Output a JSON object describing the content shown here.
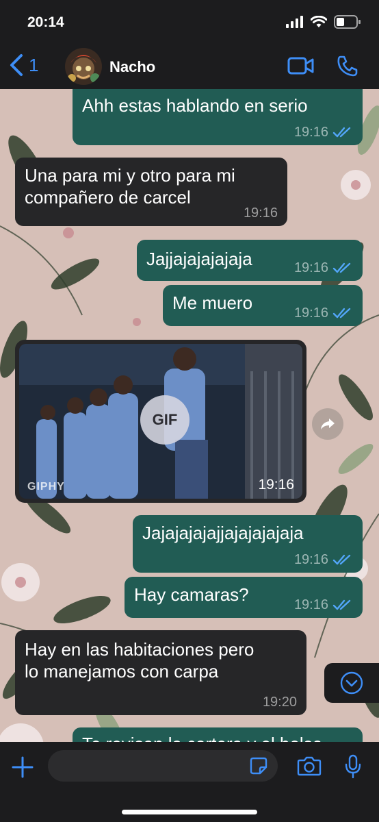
{
  "status_bar": {
    "time": "20:14",
    "icons": [
      "signal-icon",
      "wifi-icon",
      "battery-icon"
    ]
  },
  "header": {
    "back_count": "1",
    "contact_name": "Nacho",
    "icons": [
      "back-chevron-icon",
      "avatar",
      "video-call-icon",
      "voice-call-icon"
    ]
  },
  "messages": [
    {
      "dir": "out",
      "text": "Ahh estas hablando en serio",
      "time": "19:16",
      "status": "read"
    },
    {
      "dir": "in",
      "text": "Una para mi y otro para mi\ncompañero de carcel",
      "time": "19:16"
    },
    {
      "dir": "out",
      "text": "Jajjajajajajaja",
      "time": "19:16",
      "status": "read"
    },
    {
      "dir": "out",
      "text": "Me muero",
      "time": "19:16",
      "status": "read"
    },
    {
      "dir": "in",
      "type": "gif",
      "badge": "GIF",
      "source": "GIPHY",
      "time": "19:16"
    },
    {
      "dir": "out",
      "text": "Jajajajajajjajajajajaja",
      "time": "19:16",
      "status": "read"
    },
    {
      "dir": "out",
      "text": "Hay camaras?",
      "time": "19:16",
      "status": "read"
    },
    {
      "dir": "in",
      "text": "Hay en las habitaciones pero\nlo manejamos con carpa",
      "time": "19:20"
    },
    {
      "dir": "out",
      "text": "Te revisan la cartera y el bolso",
      "time": "",
      "status": "partially-visible"
    }
  ],
  "input_bar": {
    "placeholder": "",
    "icons": [
      "plus-icon",
      "sticker-icon",
      "camera-icon",
      "microphone-icon"
    ]
  },
  "colors": {
    "outgoing_bubble": "#215c54",
    "incoming_bubble": "#262628",
    "accent_blue": "#3e8ef7",
    "read_ticks": "#53a6fa",
    "bar_background": "#1c1c1e"
  }
}
